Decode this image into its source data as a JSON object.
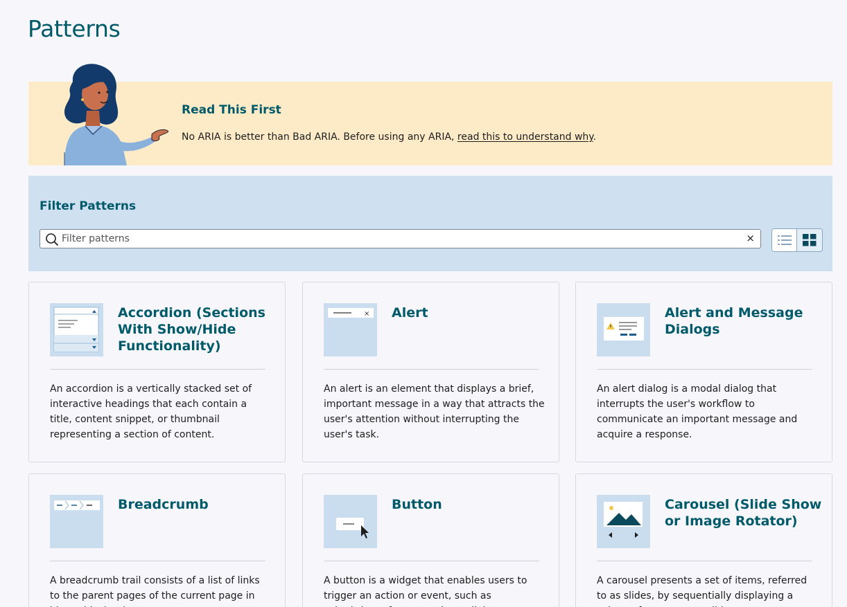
{
  "page": {
    "title": "Patterns"
  },
  "banner": {
    "title": "Read This First",
    "text_before": "No ARIA is better than Bad ARIA. Before using any ARIA, ",
    "link": "read this to understand why",
    "text_after": "."
  },
  "filter": {
    "title": "Filter Patterns",
    "placeholder": "Filter patterns",
    "clear_label": "×"
  },
  "colors": {
    "accent": "#005a6a",
    "banner_bg": "#fdebc8",
    "filter_bg": "#cfe0f0",
    "thumb_bg": "#c9ddee"
  },
  "cards": [
    {
      "title": "Accordion (Sections With Show/Hide Functionality)",
      "icon": "accordion-icon",
      "description": "An accordion is a vertically stacked set of interactive headings that each contain a title, content snippet, or thumbnail representing a section of content."
    },
    {
      "title": "Alert",
      "icon": "alert-icon",
      "description": "An alert is an element that displays a brief, important message in a way that attracts the user's attention without interrupting the user's task."
    },
    {
      "title": "Alert and Message Dialogs",
      "icon": "alert-dialog-icon",
      "description": "An alert dialog is a modal dialog that interrupts the user's workflow to communicate an important message and acquire a response."
    },
    {
      "title": "Breadcrumb",
      "icon": "breadcrumb-icon",
      "description": "A breadcrumb trail consists of a list of links to the parent pages of the current page in hierarchical order."
    },
    {
      "title": "Button",
      "icon": "button-icon",
      "description": "A button is a widget that enables users to trigger an action or event, such as submitting a form, opening a dialog."
    },
    {
      "title": "Carousel (Slide Show or Image Rotator)",
      "icon": "carousel-icon",
      "description": "A carousel presents a set of items, referred to as slides, by sequentially displaying a subset of one or more slides."
    }
  ]
}
